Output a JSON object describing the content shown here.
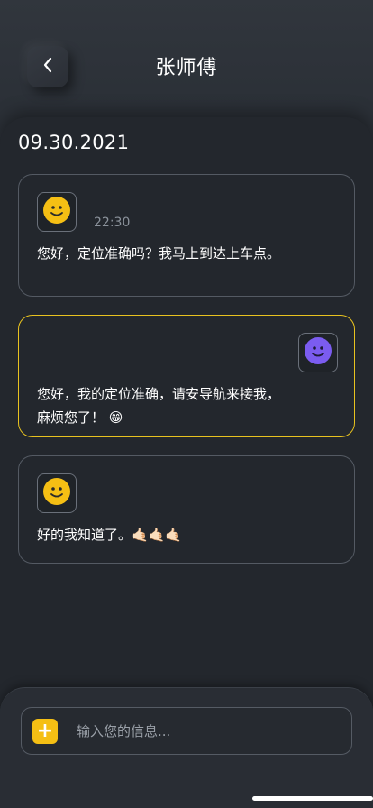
{
  "header": {
    "back_icon": "chevron-left-icon",
    "title": "张师傅"
  },
  "chat": {
    "date": "09.30.2021",
    "messages": [
      {
        "sender": "other",
        "avatar_icon": "smiley-face-icon",
        "avatar_color": "#f5bf14",
        "time": "22:30",
        "text": "您好，定位准确吗？我马上到达上车点。"
      },
      {
        "sender": "me",
        "avatar_icon": "smiley-face-icon",
        "avatar_color": "#7b5cf0",
        "border_color": "#e8c21f",
        "line1": "您好，我的定位准确，请安导航来接我，",
        "line2": "麻烦您了！",
        "emoji": "😁"
      },
      {
        "sender": "other",
        "avatar_icon": "smiley-face-icon",
        "avatar_color": "#f5bf14",
        "text": "好的我知道了。",
        "emoji": "🤙🏻🤙🏻🤙🏻"
      }
    ]
  },
  "composer": {
    "add_icon": "plus-icon",
    "add_label": "+",
    "placeholder": "输入您的信息..."
  },
  "colors": {
    "background": "#2b3037",
    "panel": "#23272d",
    "accent_yellow": "#f5bf14",
    "accent_purple": "#7b5cf0"
  }
}
